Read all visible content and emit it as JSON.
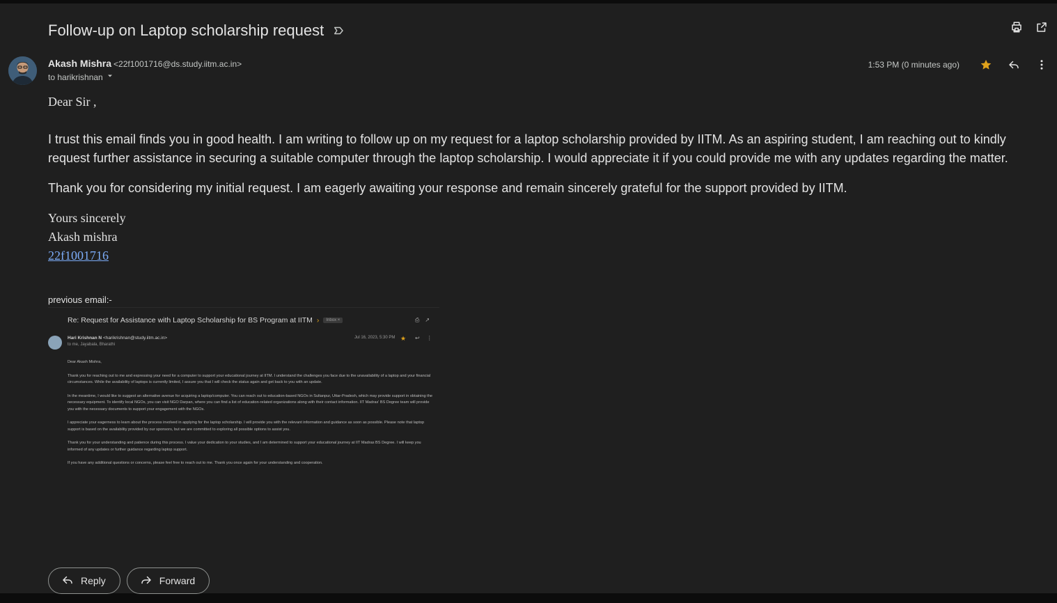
{
  "email": {
    "subject": "Follow-up on Laptop scholarship request",
    "sender_name": "Akash Mishra",
    "sender_email": "<22f1001716@ds.study.iitm.ac.in>",
    "to_text": "to harikrishnan",
    "timestamp": "1:53 PM (0 minutes ago)",
    "greeting": "Dear Sir ,",
    "paragraphs": [
      "I trust this email finds you in good health. I am writing to follow up on my request for a laptop scholarship provided by IITM. As an aspiring student, I am reaching out to kindly request further assistance in securing a suitable computer through the laptop scholarship. I would appreciate it if you could provide me with any updates regarding the matter.",
      "Thank you for considering my initial request. I am eagerly awaiting your response and remain sincerely grateful for the support provided by IITM."
    ],
    "signature": {
      "closing": "Yours sincerely",
      "name": "Akash mishra",
      "id_link": "22f1001716"
    },
    "previous_label": "previous email:-"
  },
  "previous_email": {
    "subject": "Re: Request for Assistance with Laptop Scholarship for BS Program at IITM",
    "tag": "Inbox ×",
    "from_name": "Hari Krishnan N",
    "from_email": "<harikrishnan@study.iitm.ac.in>",
    "to": "to me, Jayabala, Bharathi",
    "date": "Jul 16, 2023, 5:30 PM",
    "greeting": "Dear Akash Mishra,",
    "paragraphs": [
      "Thank you for reaching out to me and expressing your need for a computer to support your educational journey at IITM. I understand the challenges you face due to the unavailability of a laptop and your financial circumstances. While the availability of laptops is currently limited, I assure you that I will check the status again and get back to you with an update.",
      "In the meantime, I would like to suggest an alternative avenue for acquiring a laptop/computer. You can reach out to education-based NGOs in Sultanpur, Uttar-Pradesh, which may provide support in obtaining the necessary equipment. To identify local NGOs, you can visit NGO Darpan, where you can find a list of education-related organizations along with their contact information. IIT Madras' BS Degree team will provide you with the necessary documents to support your engagement with the NGOs.",
      "I appreciate your eagerness to learn about the process involved in applying for the laptop scholarship. I will provide you with the relevant information and guidance as soon as possible. Please note that laptop support is based on the availability provided by our sponsors, but we are committed to exploring all possible options to assist you.",
      "Thank you for your understanding and patience during this process. I value your dedication to your studies, and I am determined to support your educational journey at IIT Madras BS Degree. I will keep you informed of any updates or further guidance regarding laptop support.",
      "If you have any additional questions or concerns, please feel free to reach out to me. Thank you once again for your understanding and cooperation."
    ]
  },
  "actions": {
    "reply": "Reply",
    "forward": "Forward"
  },
  "icons": {
    "print": "print-icon",
    "open_new": "open-in-new-icon",
    "star": "star-icon",
    "reply": "reply-icon",
    "more": "more-vert-icon",
    "label": "label-icon",
    "forward": "forward-icon"
  },
  "colors": {
    "background": "#1f1f1f",
    "star": "#e0a21b",
    "link": "#7cacf8"
  }
}
